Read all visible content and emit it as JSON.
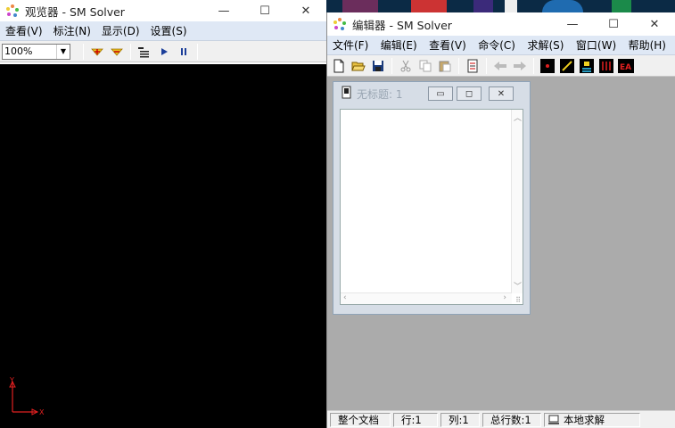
{
  "viewer": {
    "title": "观览器 - SM Solver",
    "menu": [
      "查看(V)",
      "标注(N)",
      "显示(D)",
      "设置(S)"
    ],
    "zoom_value": "100%",
    "axes": {
      "y_label": "Y",
      "x_label": "X"
    }
  },
  "editor": {
    "title": "编辑器 - SM Solver",
    "menu": [
      "文件(F)",
      "编辑(E)",
      "查看(V)",
      "命令(C)",
      "求解(S)",
      "窗口(W)",
      "帮助(H)"
    ],
    "child": {
      "title": "无标题: 1"
    },
    "status": {
      "scope": "整个文档",
      "row": "行:1",
      "col": "列:1",
      "total_rows": "总行数:1",
      "mode": "本地求解"
    }
  },
  "window_controls": {
    "minimize": "—",
    "maximize": "☐",
    "close": "✕"
  },
  "colors": {
    "menubar_bg": "#dfe8f5",
    "viewport_bg": "#000000",
    "mdi_bg": "#ababab",
    "axis_red": "#e02020"
  },
  "icons": [
    "app-logo-icon",
    "zoom-in-icon",
    "zoom-out-icon",
    "toggle-list-icon",
    "play-icon",
    "pause-icon",
    "new-file-icon",
    "open-folder-icon",
    "save-icon",
    "cut-icon",
    "copy-icon",
    "paste-icon",
    "script-icon",
    "arrow-left-icon",
    "arrow-right-icon",
    "point-icon",
    "line-icon",
    "solve-icon",
    "constraints-icon",
    "ea-icon"
  ]
}
